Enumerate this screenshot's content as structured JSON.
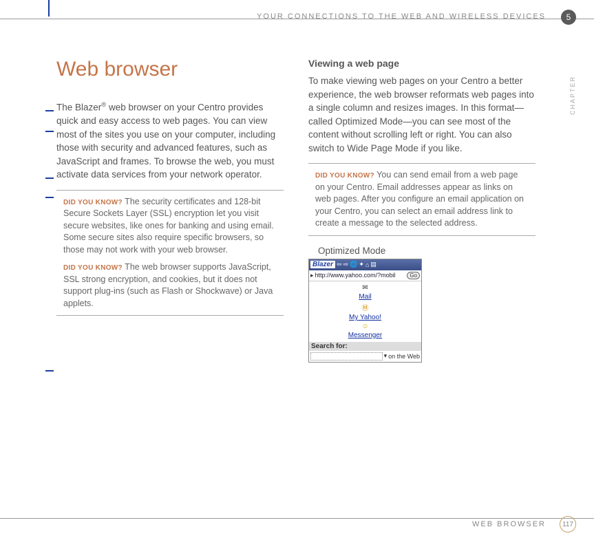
{
  "header": {
    "text": "YOUR CONNECTIONS TO THE WEB AND WIRELESS DEVICES",
    "chapter_number": "5",
    "chapter_label": "CHAPTER"
  },
  "left": {
    "title": "Web browser",
    "intro_pre": "The Blazer",
    "intro_post": " web browser on your Centro provides quick and easy access to web pages. You can view most of the sites you use on your computer, including those with security and advanced features, such as JavaScript and frames. To browse the web, you must activate data services from your network operator.",
    "dyk_label": "DID YOU KNOW?",
    "dyk1": " The security certificates and 128-bit Secure Sockets Layer (SSL) encryption let you visit secure websites, like ones for banking and using email. Some secure sites also require specific browsers, so those may not work with your web browser.",
    "dyk2": " The web browser supports JavaScript, SSL strong encryption, and cookies, but it does not support plug-ins (such as Flash or Shockwave) or Java applets."
  },
  "right": {
    "subtitle": "Viewing a web page",
    "body": "To make viewing web pages on your Centro a better experience, the web browser reformats web pages into a single column and resizes images. In this format—called Optimized Mode—you can see most of the content without scrolling left or right. You can also switch to Wide Page Mode if you like.",
    "dyk_label": "DID YOU KNOW?",
    "dyk": " You can send email from a web page on your Centro. Email addresses appear as links on web pages. After you configure an email application on your Centro, you can select an email address link to create a message to the selected address.",
    "mode_label": "Optimized Mode"
  },
  "phone": {
    "app_name": "Blazer",
    "url_prefix": "▸",
    "url": "http://www.yahoo.com/?mobil",
    "go": "Go",
    "link_mail": "Mail",
    "link_myyahoo": "My Yahoo!",
    "link_messenger": "Messenger",
    "search_label": "Search for:",
    "dropdown": "on the Web"
  },
  "footer": {
    "text": "WEB BROWSER",
    "page": "117"
  }
}
